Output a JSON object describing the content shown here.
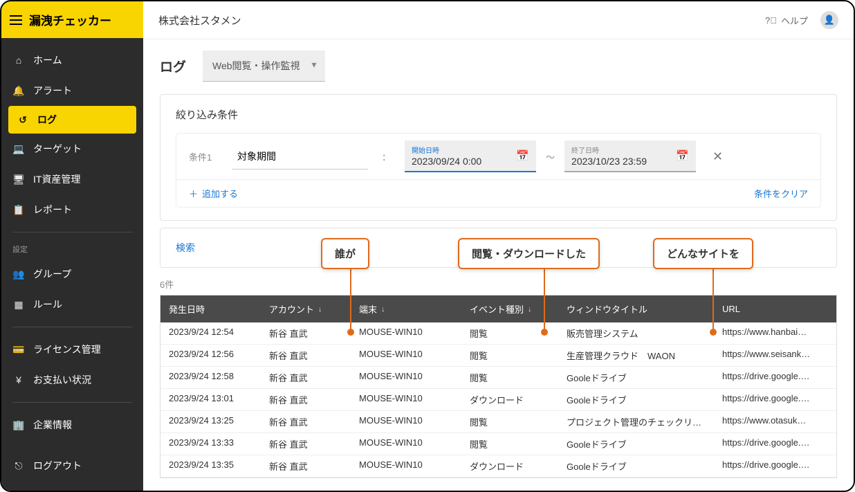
{
  "brand": "漏洩チェッカー",
  "company": "株式会社スタメン",
  "help_label": "ヘルプ",
  "sidebar": {
    "items": [
      {
        "icon": "home",
        "label": "ホーム"
      },
      {
        "icon": "bell",
        "label": "アラート"
      },
      {
        "icon": "history",
        "label": "ログ",
        "active": true
      },
      {
        "icon": "laptop",
        "label": "ターゲット"
      },
      {
        "icon": "device",
        "label": "IT資産管理"
      },
      {
        "icon": "clipboard",
        "label": "レポート"
      }
    ],
    "settings_label": "設定",
    "settings_items": [
      {
        "icon": "group",
        "label": "グループ"
      },
      {
        "icon": "grid",
        "label": "ルール"
      }
    ],
    "bottom_items": [
      {
        "icon": "card",
        "label": "ライセンス管理"
      },
      {
        "icon": "yen",
        "label": "お支払い状況"
      }
    ],
    "corp_label": "企業情報",
    "logout_label": "ログアウト"
  },
  "page": {
    "title": "ログ",
    "dropdown": "Web閲覧・操作監視"
  },
  "filter": {
    "title": "絞り込み条件",
    "cond_label": "条件1",
    "cond_field": "対象期間",
    "start_label": "開始日時",
    "start_value": "2023/09/24 0:00",
    "end_label": "終了日時",
    "end_value": "2023/10/23 23:59",
    "add_label": "追加する",
    "clear_label": "条件をクリア"
  },
  "search_label": "検索",
  "count_label": "6件",
  "callouts": {
    "who": "誰が",
    "action": "閲覧・ダウンロードした",
    "site": "どんなサイトを"
  },
  "table": {
    "headers": {
      "date": "発生日時",
      "account": "アカウント",
      "terminal": "端末",
      "event": "イベント種別",
      "title": "ウィンドウタイトル",
      "url": "URL"
    },
    "rows": [
      {
        "date": "2023/9/24 12:54",
        "account": "新谷 直武",
        "terminal": "MOUSE-WIN10",
        "event": "閲覧",
        "title": "販売管理システム",
        "url": "https://www.hanbai…"
      },
      {
        "date": "2023/9/24 12:56",
        "account": "新谷 直武",
        "terminal": "MOUSE-WIN10",
        "event": "閲覧",
        "title": "生産管理クラウド　WAON",
        "url": "https://www.seisank…"
      },
      {
        "date": "2023/9/24 12:58",
        "account": "新谷 直武",
        "terminal": "MOUSE-WIN10",
        "event": "閲覧",
        "title": "Gooleドライブ",
        "url": "https://drive.google.…"
      },
      {
        "date": "2023/9/24 13:01",
        "account": "新谷 直武",
        "terminal": "MOUSE-WIN10",
        "event": "ダウンロード",
        "title": "Gooleドライブ",
        "url": "https://drive.google.…"
      },
      {
        "date": "2023/9/24 13:25",
        "account": "新谷 直武",
        "terminal": "MOUSE-WIN10",
        "event": "閲覧",
        "title": "プロジェクト管理のチェックリ…",
        "url": "https://www.otasuk…"
      },
      {
        "date": "2023/9/24 13:33",
        "account": "新谷 直武",
        "terminal": "MOUSE-WIN10",
        "event": "閲覧",
        "title": "Gooleドライブ",
        "url": "https://drive.google.…"
      },
      {
        "date": "2023/9/24 13:35",
        "account": "新谷 直武",
        "terminal": "MOUSE-WIN10",
        "event": "ダウンロード",
        "title": "Gooleドライブ",
        "url": "https://drive.google.…"
      }
    ]
  }
}
